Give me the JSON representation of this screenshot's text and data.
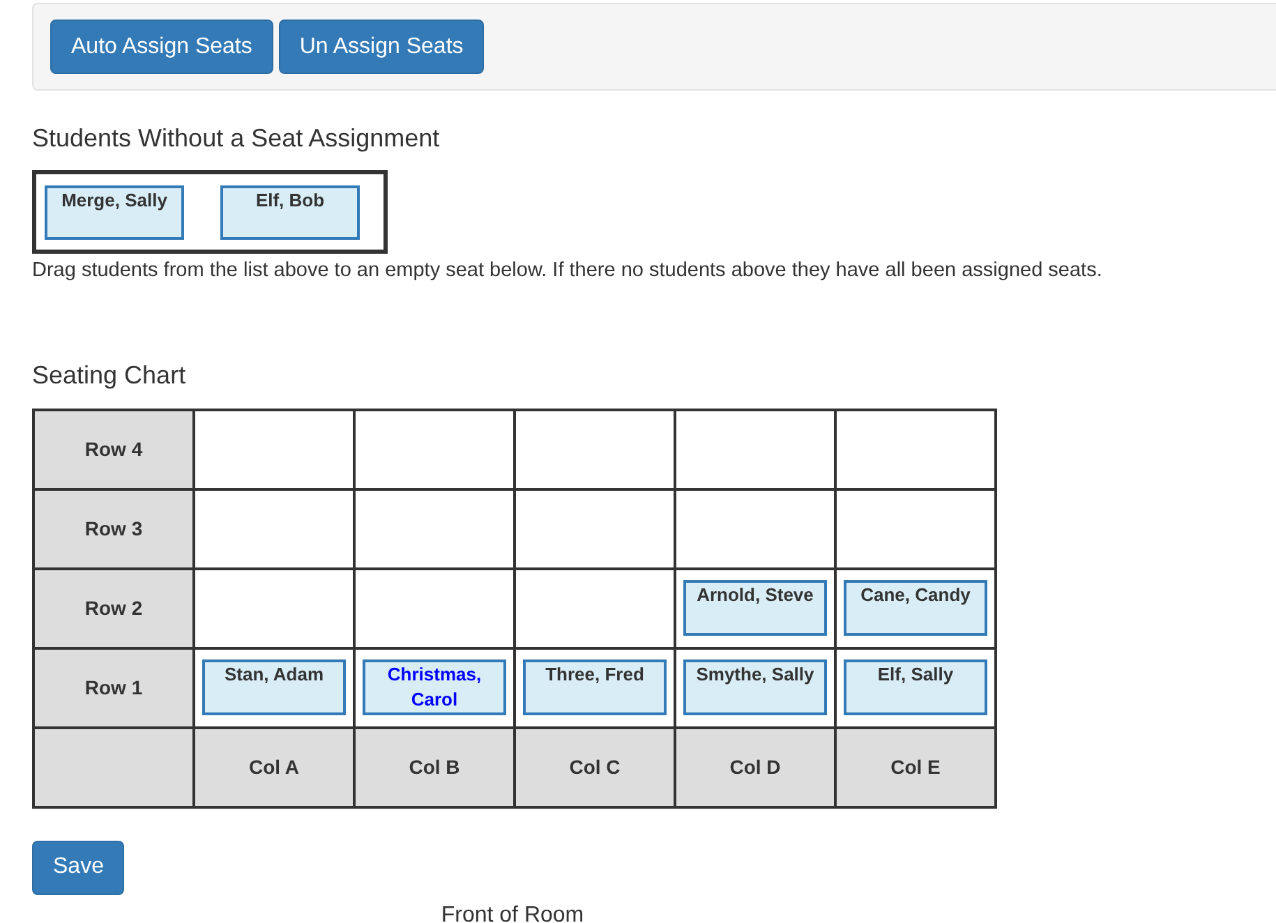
{
  "toolbar": {
    "buttons": [
      "Auto Assign Seats",
      "Un Assign Seats"
    ]
  },
  "unassigned": {
    "title": "Students Without a Seat Assignment",
    "students": [
      {
        "name": "Merge, Sally",
        "highlighted": false
      },
      {
        "name": "Elf, Bob",
        "highlighted": false
      }
    ],
    "instructions": "Drag students from the list above to an empty seat below. If there no students above they have all been assigned seats."
  },
  "seating_chart": {
    "title": "Seating Chart",
    "rows": [
      {
        "label": "Row 4",
        "seats": [
          {
            "kind": "empty"
          },
          {
            "kind": "empty"
          },
          {
            "kind": "empty"
          },
          {
            "kind": "empty"
          },
          {
            "kind": "empty"
          }
        ]
      },
      {
        "label": "Row 3",
        "seats": [
          {
            "kind": "empty"
          },
          {
            "kind": "empty"
          },
          {
            "kind": "empty"
          },
          {
            "kind": "empty"
          },
          {
            "kind": "empty"
          }
        ]
      },
      {
        "label": "Row 2",
        "seats": [
          {
            "kind": "empty"
          },
          {
            "kind": "empty"
          },
          {
            "kind": "empty"
          },
          {
            "kind": "student",
            "name": "Arnold, Steve",
            "highlighted": false
          },
          {
            "kind": "student",
            "name": "Cane, Candy",
            "highlighted": false
          }
        ]
      },
      {
        "label": "Row 1",
        "seats": [
          {
            "kind": "student",
            "name": "Stan, Adam",
            "highlighted": false
          },
          {
            "kind": "student",
            "name": "Christmas, Carol",
            "highlighted": true
          },
          {
            "kind": "student",
            "name": "Three, Fred",
            "highlighted": false
          },
          {
            "kind": "student",
            "name": "Smythe, Sally",
            "highlighted": false
          },
          {
            "kind": "student",
            "name": "Elf, Sally",
            "highlighted": false
          }
        ]
      }
    ],
    "columns": [
      "Col A",
      "Col B",
      "Col C",
      "Col D",
      "Col E"
    ]
  },
  "save_button": "Save",
  "front_label": "Front of Room"
}
